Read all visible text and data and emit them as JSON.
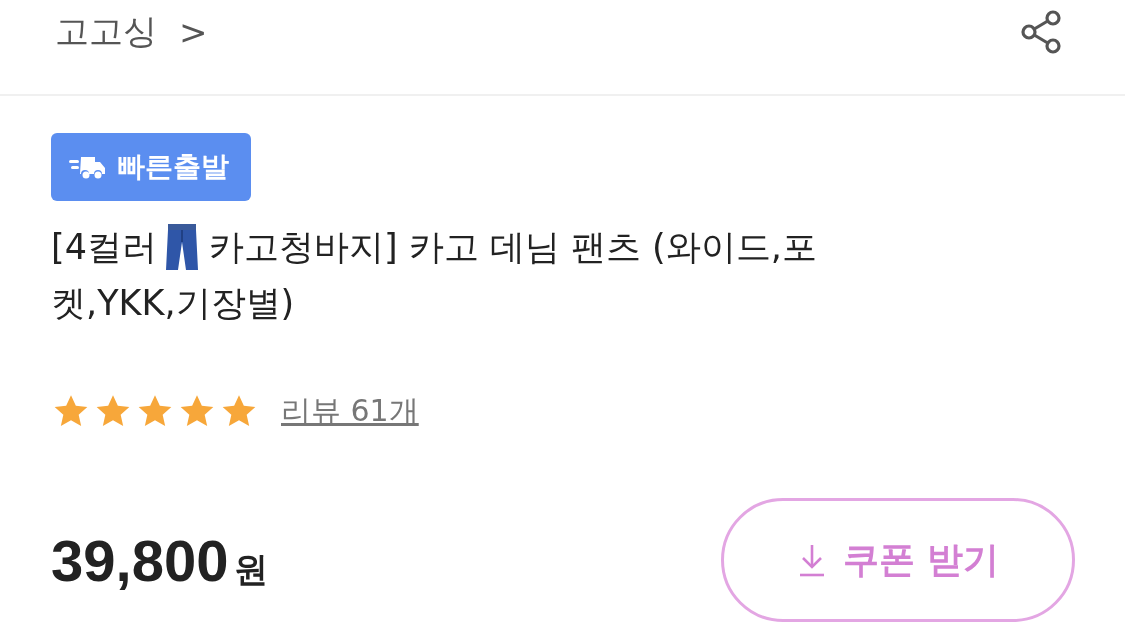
{
  "header": {
    "store_name": "고고싱",
    "chevron": ">"
  },
  "badge": {
    "label": "빠른출발"
  },
  "title_parts": [
    "[4컬러",
    "카고청바지] 카고 데님 팬츠 (와이드,포",
    "켓,YKK,기장별)"
  ],
  "rating": {
    "stars": 5,
    "review_link": "리뷰 61개"
  },
  "price": {
    "amount": "39,800",
    "unit": "원"
  },
  "coupon_button": {
    "label": "쿠폰 받기"
  }
}
